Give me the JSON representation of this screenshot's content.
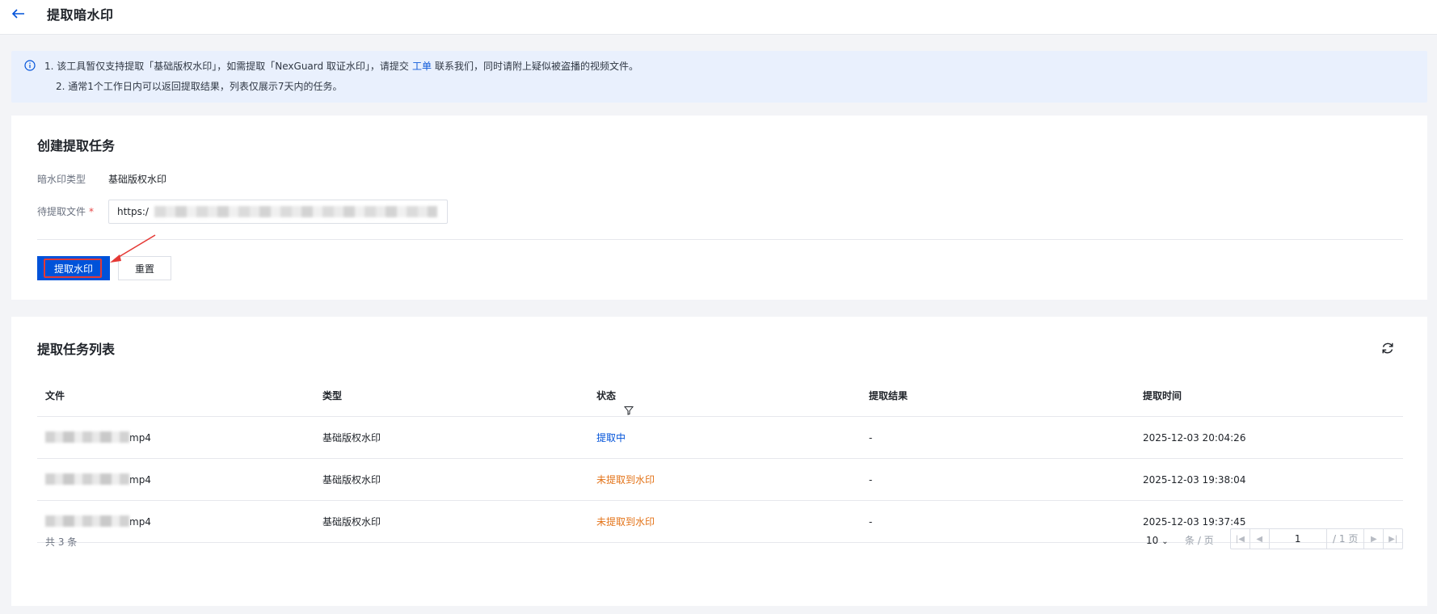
{
  "header": {
    "title": "提取暗水印"
  },
  "notice": {
    "line1_prefix": "1. 该工具暂仅支持提取「基础版权水印」，如需提取「NexGuard 取证水印」，请提交",
    "link": "工单",
    "line1_suffix": "联系我们，同时请附上疑似被盗播的视频文件。",
    "line2": "2. 通常1个工作日内可以返回提取结果，列表仅展示7天内的任务。"
  },
  "create": {
    "title": "创建提取任务",
    "type_label": "暗水印类型",
    "type_value": "基础版权水印",
    "file_label": "待提取文件",
    "required_mark": "*",
    "file_value": "https:/",
    "submit_label": "提取水印",
    "reset_label": "重置"
  },
  "list": {
    "title": "提取任务列表",
    "columns": [
      "文件",
      "类型",
      "状态",
      "提取结果",
      "提取时间"
    ],
    "rows": [
      {
        "file_suffix": "mp4",
        "type": "基础版权水印",
        "status": "提取中",
        "result": "-",
        "time": "2025-12-03 20:04:26"
      },
      {
        "file_suffix": "mp4",
        "type": "基础版权水印",
        "status": "未提取到水印",
        "result": "-",
        "time": "2025-12-03 19:38:04"
      },
      {
        "file_suffix": "mp4",
        "type": "基础版权水印",
        "status": "未提取到水印",
        "result": "-",
        "time": "2025-12-03 19:37:45"
      }
    ],
    "total": "共 3 条",
    "page_size": "10",
    "per_page": "条 / 页",
    "current_page": "1",
    "total_pages": "/ 1 页"
  },
  "colors": {
    "accent": "#0052d9",
    "warning": "#e37318",
    "notice_bg": "#e9f0fd",
    "highlight": "#e53935"
  }
}
